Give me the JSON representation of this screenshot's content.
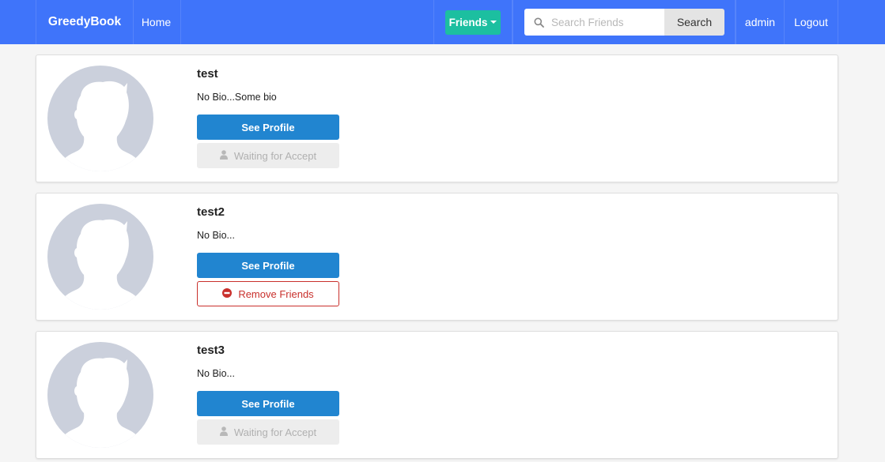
{
  "navbar": {
    "brand": "GreedyBook",
    "home": "Home",
    "friends_label": "Friends",
    "search_placeholder": "Search Friends",
    "search_button": "Search",
    "user": "admin",
    "logout": "Logout",
    "bar_color": "#3f74fa",
    "friends_color": "#1cbfa0"
  },
  "friends": [
    {
      "name": "test",
      "bio": "No Bio...Some bio",
      "primary_action": "See Profile",
      "secondary_action": "Waiting for Accept",
      "secondary_state": "waiting",
      "secondary_icon": "user-icon"
    },
    {
      "name": "test2",
      "bio": "No Bio...",
      "primary_action": "See Profile",
      "secondary_action": "Remove Friends",
      "secondary_state": "remove",
      "secondary_icon": "minus-circle-icon"
    },
    {
      "name": "test3",
      "bio": "No Bio...",
      "primary_action": "See Profile",
      "secondary_action": "Waiting for Accept",
      "secondary_state": "waiting",
      "secondary_icon": "user-icon"
    }
  ]
}
